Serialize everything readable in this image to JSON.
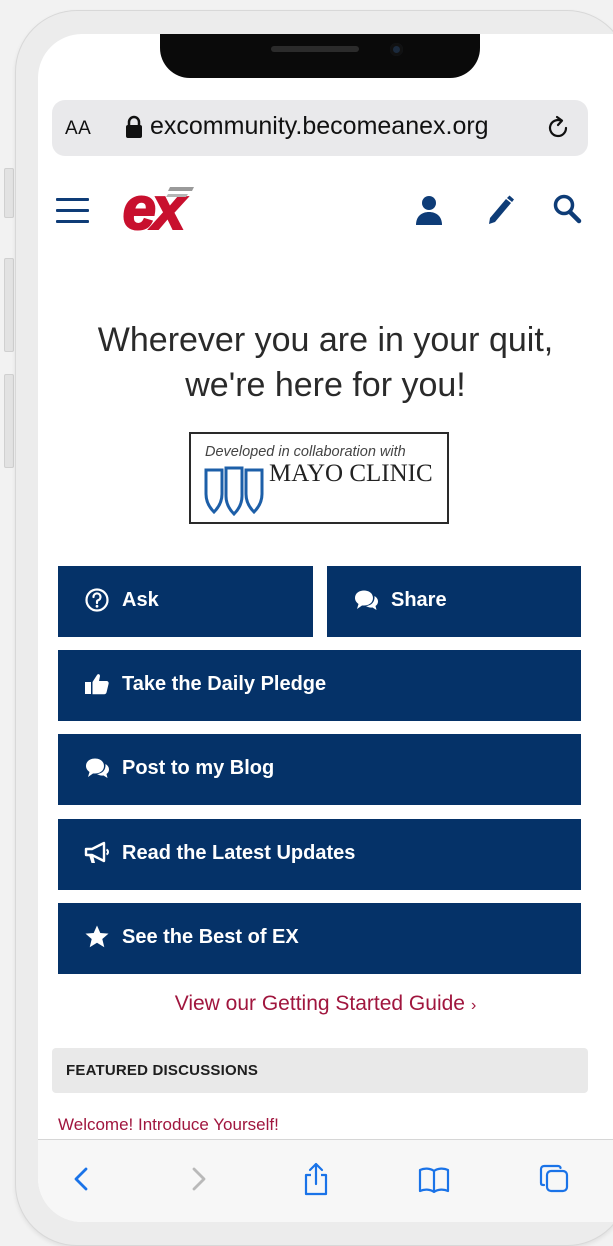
{
  "browser": {
    "text_size_label": "AA",
    "url": "excommunity.becomeanex.org"
  },
  "site": {
    "logo_text": "ex"
  },
  "hero": {
    "headline_line1": "Wherever you are in your quit,",
    "headline_line2": "we're here for you!"
  },
  "badge": {
    "developed_text": "Developed in collaboration with",
    "clinic_name": "MAYO CLINIC"
  },
  "actions": {
    "ask": "Ask",
    "share": "Share",
    "pledge": "Take the Daily Pledge",
    "blog": "Post to my Blog",
    "updates": "Read the Latest Updates",
    "best": "See the Best of EX"
  },
  "guide_link": "View our Getting Started Guide",
  "featured": {
    "heading": "FEATURED DISCUSSIONS",
    "first_item": "Welcome! Introduce Yourself!"
  },
  "colors": {
    "navy": "#053268",
    "brand_red": "#c8102e",
    "link_red": "#a0163e",
    "ios_blue": "#1a73e8"
  },
  "icons": [
    "lock-icon",
    "reload-icon",
    "menu-icon",
    "user-icon",
    "pencil-icon",
    "search-icon",
    "question-icon",
    "comments-icon",
    "thumbs-up-icon",
    "bullhorn-icon",
    "star-icon",
    "back-icon",
    "forward-icon",
    "share-icon",
    "bookmarks-icon",
    "tabs-icon"
  ]
}
